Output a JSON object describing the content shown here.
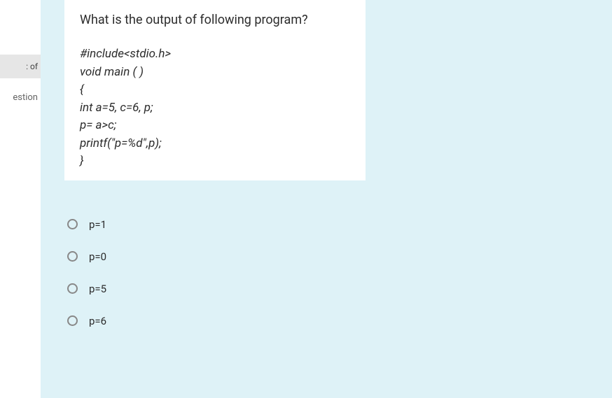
{
  "sidebar": {
    "items": [
      {
        "label": ": of"
      },
      {
        "label": "estion"
      }
    ]
  },
  "question": {
    "title": "What is the output of following program?",
    "code": {
      "line1": "#include<stdio.h>",
      "line2": "void main ( )",
      "line3": "{",
      "line4": "int  a=5, c=6, p;",
      "line5": "p= a>c;",
      "line6": "printf(\"p=%d\",p);",
      "line7": "}"
    },
    "options": [
      {
        "label": "p=1"
      },
      {
        "label": "p=0"
      },
      {
        "label": "p=5"
      },
      {
        "label": "p=6"
      }
    ]
  }
}
